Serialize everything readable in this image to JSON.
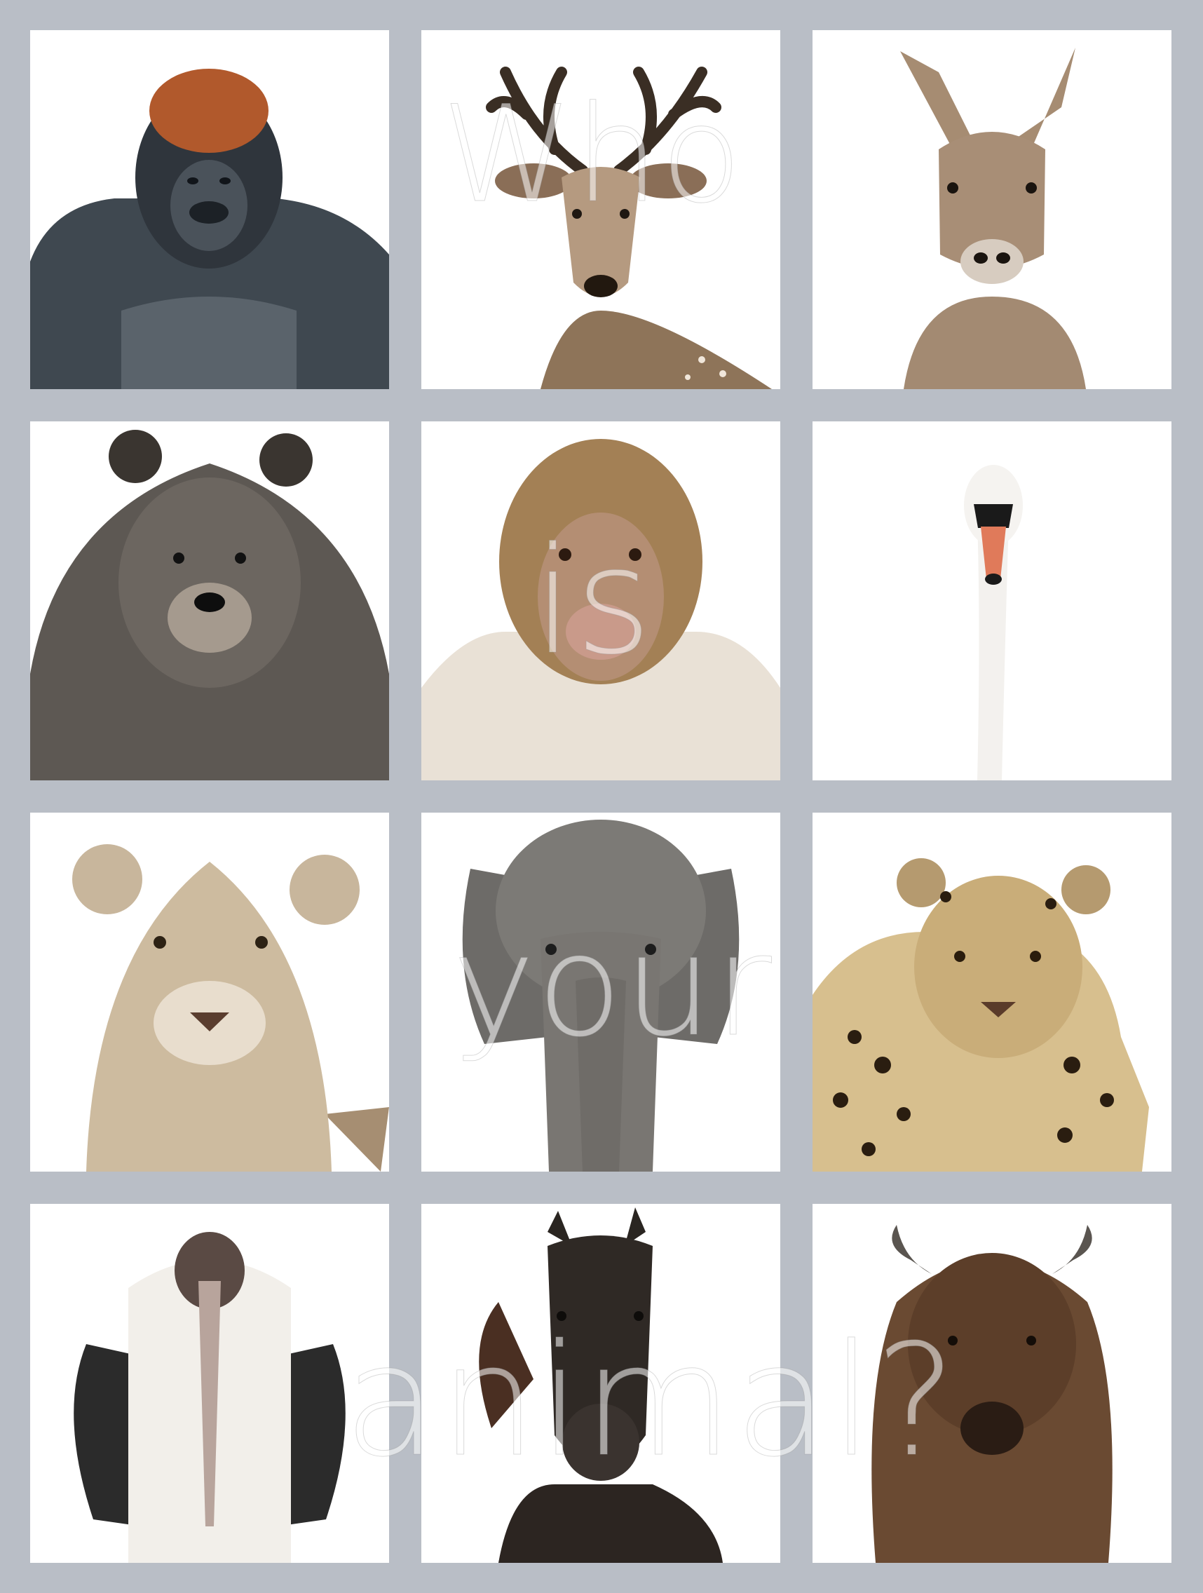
{
  "overlay_text": {
    "line1": "Who",
    "line2": "is",
    "line3": "your",
    "line4": "animal?"
  },
  "colors": {
    "background": "#b9bec6",
    "tile": "#ffffff",
    "overlay_text": "#ffffff"
  },
  "tiles": [
    {
      "animal": "gorilla"
    },
    {
      "animal": "deer"
    },
    {
      "animal": "mara"
    },
    {
      "animal": "bear"
    },
    {
      "animal": "macaque"
    },
    {
      "animal": "swan"
    },
    {
      "animal": "lioness"
    },
    {
      "animal": "elephant"
    },
    {
      "animal": "jaguar"
    },
    {
      "animal": "marabou-stork"
    },
    {
      "animal": "horse"
    },
    {
      "animal": "bison"
    }
  ]
}
